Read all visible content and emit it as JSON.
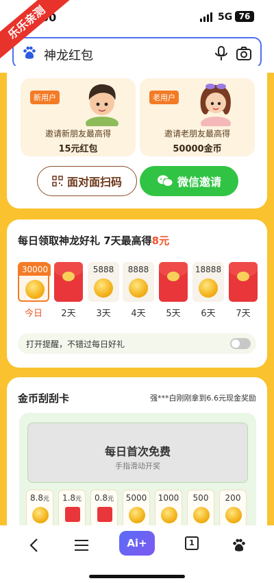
{
  "watermark": "乐乐亲测",
  "status_bar": {
    "time": "50",
    "network": "5G",
    "battery": "76"
  },
  "search": {
    "query": "神龙红包"
  },
  "invite": {
    "new_user": {
      "tag": "新用户",
      "desc": "邀请新朋友最高得",
      "reward": "15元红包"
    },
    "old_user": {
      "tag": "老用户",
      "desc": "邀请老朋友最高得",
      "reward": "50000金币"
    },
    "scan_button": "面对面扫码",
    "wechat_button": "微信邀请"
  },
  "daily": {
    "title_main": "每日领取神龙好礼 7天最高得",
    "title_highlight": "8元",
    "days": [
      {
        "amount": "30000",
        "kind": "coin",
        "label": "今日",
        "today": true
      },
      {
        "amount": "",
        "kind": "envelope",
        "label": "2天"
      },
      {
        "amount": "5888",
        "kind": "coin",
        "label": "3天"
      },
      {
        "amount": "8888",
        "kind": "coin",
        "label": "4天"
      },
      {
        "amount": "",
        "kind": "envelope",
        "label": "5天"
      },
      {
        "amount": "18888",
        "kind": "coin",
        "label": "6天"
      },
      {
        "amount": "",
        "kind": "envelope",
        "label": "7天"
      }
    ],
    "reminder": "打开提醒，不错过每日好礼"
  },
  "scratch": {
    "title": "金币刮刮卡",
    "notice": "强***白刚刚拿到6.6元现金奖励",
    "card_title": "每日首次免费",
    "card_hint": "手指滑动开奖",
    "prizes": [
      {
        "value": "8.8",
        "unit": "元",
        "kind": "coin"
      },
      {
        "value": "1.8",
        "unit": "元",
        "kind": "envelope"
      },
      {
        "value": "0.8",
        "unit": "元",
        "kind": "envelope"
      },
      {
        "value": "5000",
        "unit": "",
        "kind": "coin"
      },
      {
        "value": "1000",
        "unit": "",
        "kind": "coin"
      },
      {
        "value": "500",
        "unit": "",
        "kind": "coin"
      },
      {
        "value": "200",
        "unit": "",
        "kind": "coin"
      }
    ]
  },
  "bottom_nav": {
    "ai_label": "Ai+",
    "tab_count": "1"
  },
  "colors": {
    "accent_orange": "#f37b26",
    "wechat_green": "#31c444",
    "brand_blue": "#4e6ef2",
    "page_yellow": "#f9c22e"
  }
}
